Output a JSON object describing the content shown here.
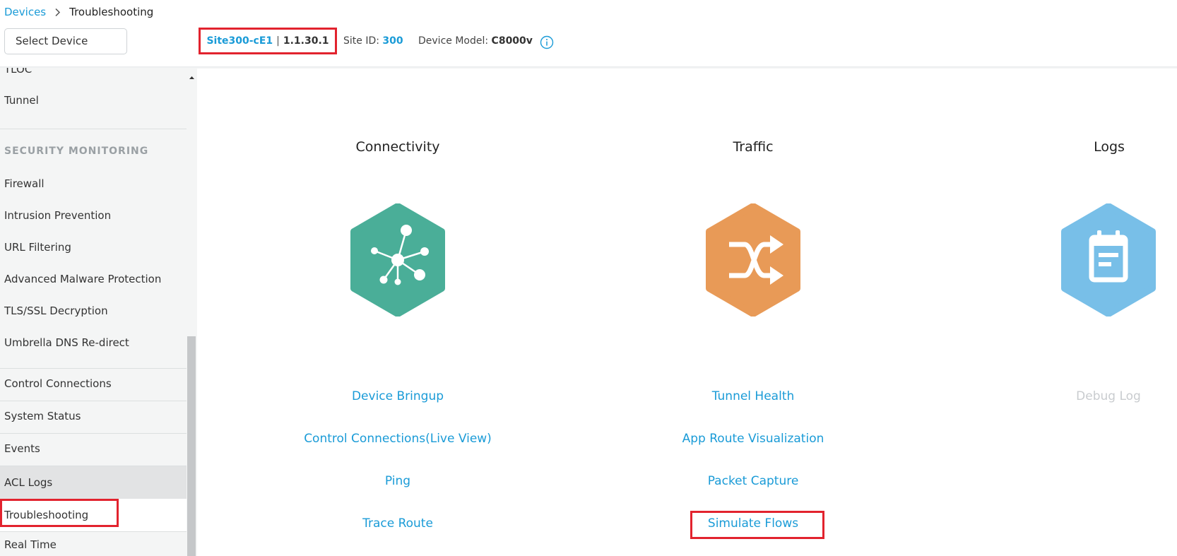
{
  "breadcrumb": {
    "parent": "Devices",
    "current": "Troubleshooting"
  },
  "select_device": {
    "label": "Select Device"
  },
  "device": {
    "name": "Site300-cE1",
    "separator": "|",
    "ip": "1.1.30.1",
    "site_id_label": "Site ID:",
    "site_id": "300",
    "model_label": "Device Model:",
    "model": "C8000v"
  },
  "sidebar": {
    "items_top": [
      "TLOC",
      "Tunnel"
    ],
    "security_heading": "SECURITY MONITORING",
    "security_items": [
      "Firewall",
      "Intrusion Prevention",
      "URL Filtering",
      "Advanced Malware Protection",
      "TLS/SSL Decryption",
      "Umbrella DNS Re-direct"
    ],
    "items_bottom": [
      "Control Connections",
      "System Status",
      "Events",
      "ACL Logs",
      "Troubleshooting",
      "Real Time"
    ]
  },
  "columns": {
    "connectivity": {
      "title": "Connectivity",
      "links": [
        "Device Bringup",
        "Control Connections(Live View)",
        "Ping",
        "Trace Route"
      ]
    },
    "traffic": {
      "title": "Traffic",
      "links": [
        "Tunnel Health",
        "App Route Visualization",
        "Packet Capture",
        "Simulate Flows"
      ]
    },
    "logs": {
      "title": "Logs",
      "links": [
        "Debug Log"
      ]
    }
  },
  "colors": {
    "link": "#1a9bd7",
    "highlight_box": "#e2232e",
    "connectivity_hex": "#4aae98",
    "traffic_hex": "#e89a57",
    "logs_hex": "#78bfe8"
  },
  "icons": {
    "connectivity": "network-hub-icon",
    "traffic": "shuffle-arrows-icon",
    "logs": "calendar-log-icon"
  }
}
